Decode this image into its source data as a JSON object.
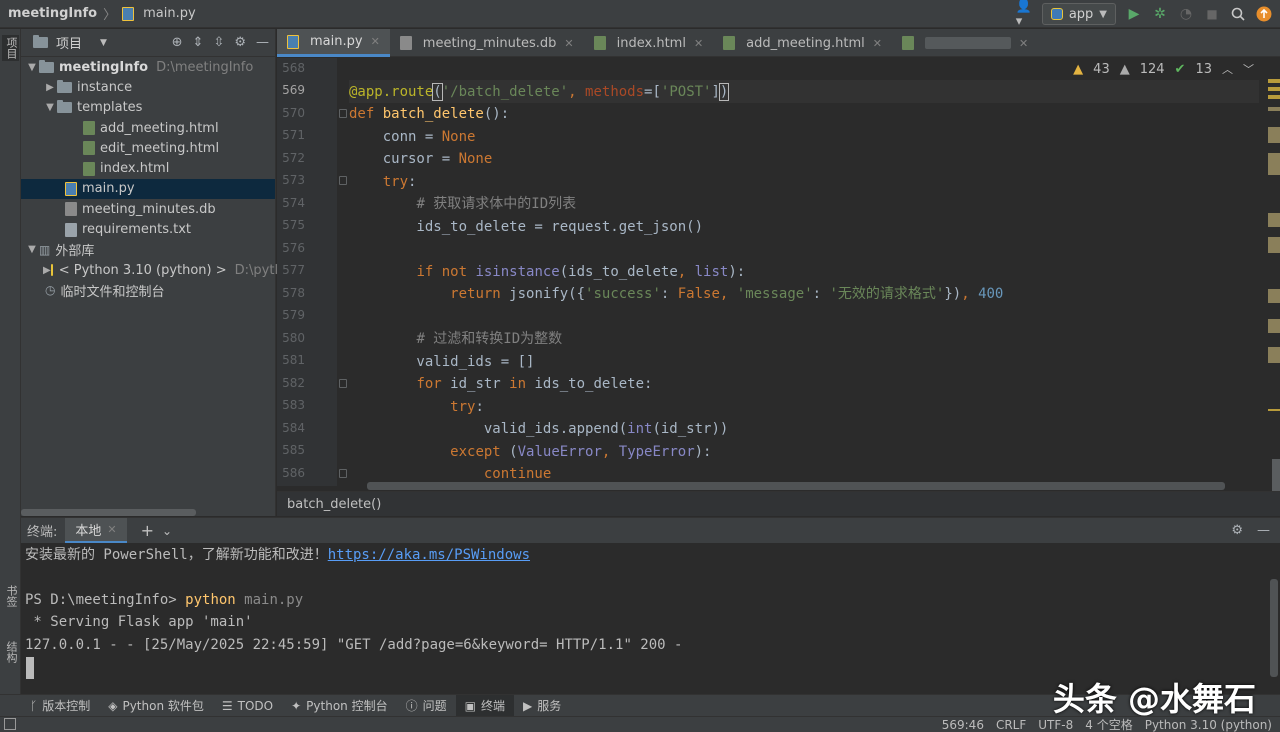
{
  "titlebar": {
    "project": "meetingInfo",
    "file": "main.py",
    "run_config": "app"
  },
  "left_stripe": {
    "project_label": "项目",
    "bookmarks_label": "书签",
    "structure_label": "结构"
  },
  "project_panel": {
    "title": "项目",
    "tree": [
      {
        "label": "meetingInfo",
        "path": "D:\\meetingInfo"
      },
      {
        "label": "instance"
      },
      {
        "label": "templates"
      },
      {
        "label": "add_meeting.html"
      },
      {
        "label": "edit_meeting.html"
      },
      {
        "label": "index.html"
      },
      {
        "label": "main.py"
      },
      {
        "label": "meeting_minutes.db"
      },
      {
        "label": "requirements.txt"
      },
      {
        "label": "外部库"
      },
      {
        "label": "< Python 3.10 (python) >",
        "path": "D:\\pytl"
      },
      {
        "label": "临时文件和控制台"
      }
    ]
  },
  "editor": {
    "tabs": [
      {
        "label": "main.py"
      },
      {
        "label": "meeting_minutes.db"
      },
      {
        "label": "index.html"
      },
      {
        "label": "add_meeting.html"
      }
    ],
    "inspections": {
      "warnings": "43",
      "weak": "124",
      "ok": "13"
    },
    "line_numbers": [
      "568",
      "569",
      "570",
      "571",
      "572",
      "573",
      "574",
      "575",
      "576",
      "577",
      "578",
      "579",
      "580",
      "581",
      "582",
      "583",
      "584",
      "585",
      "586"
    ],
    "breadcrumb": "batch_delete()"
  },
  "terminal": {
    "label": "终端:",
    "tab": "本地",
    "line1_text": "安装最新的 PowerShell，了解新功能和改进！",
    "line1_link": "https://aka.ms/PSWindows",
    "prompt": "PS D:\\meetingInfo> ",
    "cmd_python": "python",
    "cmd_arg": " main.py",
    "serving": " * Serving Flask app 'main'",
    "request_log": "127.0.0.1 - - [25/May/2025 22:45:59] \"GET /add?page=6&keyword= HTTP/1.1\" 200 -"
  },
  "toolwindows": [
    "版本控制",
    "Python 软件包",
    "TODO",
    "Python 控制台",
    "问题",
    "终端",
    "服务"
  ],
  "watermark": "头条 @水舞石",
  "status": {
    "position": "569:46",
    "line_sep": "CRLF",
    "encoding": "UTF-8",
    "indent": "4 个空格",
    "interpreter": "Python 3.10 (python)"
  },
  "colors": {
    "keyword": "#cc7832",
    "string": "#6a8759",
    "number": "#6897bb",
    "function": "#ffc66d",
    "comment": "#808080",
    "accent": "#4a88c7"
  }
}
